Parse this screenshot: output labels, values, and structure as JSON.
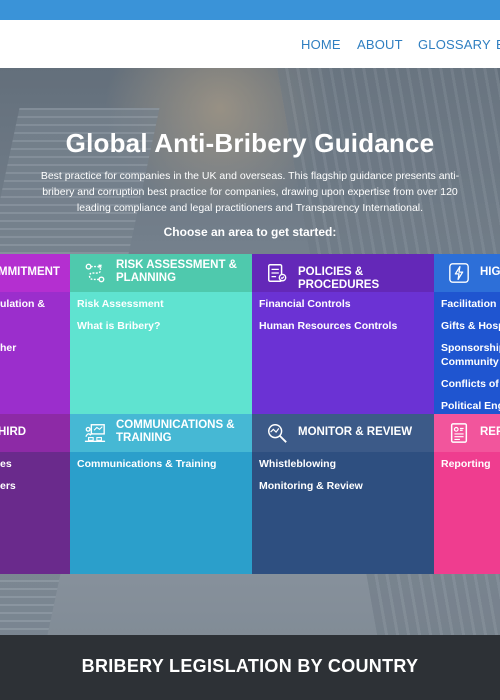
{
  "nav": {
    "items": [
      "HOME",
      "ABOUT",
      "GLOSSARY",
      "E"
    ]
  },
  "hero": {
    "title": "Global Anti-Bribery Guidance",
    "description_lines": [
      "Best practice for companies in the UK and overseas. This flagship guidance presents anti-",
      "bribery and corruption best practice for companies, drawing upon expertise from over 120",
      "leading compliance and legal practitioners and Transparency International."
    ],
    "cta": "Choose an area to get started:"
  },
  "areas": {
    "row1": [
      {
        "title_lines": [
          "MMITMENT"
        ],
        "links": [
          "ulation &",
          "",
          "her"
        ],
        "icon": "handshake-icon"
      },
      {
        "title_lines": [
          "RISK ASSESSMENT &",
          "PLANNING"
        ],
        "links": [
          "Risk Assessment",
          "What is Bribery?"
        ],
        "icon": "route-icon"
      },
      {
        "title_lines": [
          "POLICIES & PROCEDURES"
        ],
        "links": [
          "Financial Controls",
          "Human Resources Controls"
        ],
        "icon": "document-icon"
      },
      {
        "title_lines": [
          "HIGH"
        ],
        "links": [
          "Facilitation P",
          "Gifts & Hospi",
          "Sponsorship,",
          "Community I",
          "Conflicts of I",
          "Political Enga"
        ],
        "icon": "warning-icon"
      }
    ],
    "row2": [
      {
        "title_lines": [
          "HIRD"
        ],
        "links": [
          "es",
          "ers"
        ],
        "icon": "people-icon"
      },
      {
        "title_lines": [
          "COMMUNICATIONS &",
          "TRAINING"
        ],
        "links": [
          "Communications & Training"
        ],
        "icon": "presentation-icon"
      },
      {
        "title_lines": [
          "MONITOR & REVIEW"
        ],
        "links": [
          "Whistleblowing",
          "Monitoring & Review"
        ],
        "icon": "magnifier-icon"
      },
      {
        "title_lines": [
          "REPO"
        ],
        "links": [
          "Reporting"
        ],
        "icon": "report-icon"
      }
    ]
  },
  "footer": {
    "title": "BRIBERY LEGISLATION BY COUNTRY"
  },
  "colors": {
    "topstrip": "#3a93d8",
    "nav_link": "#2f7fc1",
    "commitment_head": "#b42fd0",
    "commitment_body": "#9b2ecc",
    "risk_head": "#4fc9ad",
    "risk_body": "#5fe3d0",
    "policies_head": "#6428b8",
    "policies_body": "#6b32d4",
    "high_head": "#2d6fd8",
    "high_body": "#1f55d0",
    "third_head": "#8d2aa6",
    "third_body": "#6a2a8c",
    "comms_head": "#46b8d4",
    "comms_body": "#2b9fcb",
    "monitor_head": "#3c5a88",
    "monitor_body": "#2e4f80",
    "report_head": "#f2559c",
    "report_body": "#ef3d8f",
    "footer": "#2d3136"
  }
}
